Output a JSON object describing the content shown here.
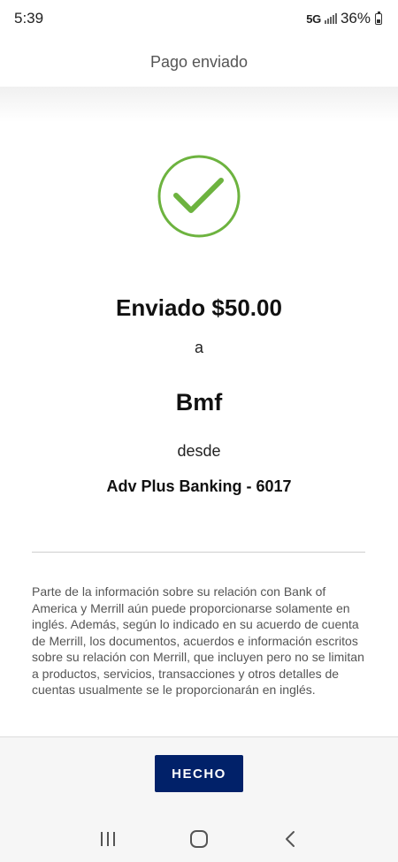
{
  "status_bar": {
    "time": "5:39",
    "network": "5G",
    "battery": "36%"
  },
  "header": {
    "title": "Pago enviado"
  },
  "confirmation": {
    "icon": "check-circle-icon",
    "check_color": "#6db33f",
    "sent_amount": "Enviado $50.00",
    "to_label": "a",
    "recipient": "Bmf",
    "from_label": "desde",
    "account": "Adv Plus Banking - 6017"
  },
  "disclaimer": "Parte de la información sobre su relación con Bank of America y Merrill aún puede proporcionarse solamente en inglés. Además, según lo indicado en su acuerdo de cuenta de Merrill, los documentos, acuerdos e información escritos sobre su relación con Merrill, que incluyen pero no se limitan a productos, servicios, transacciones y otros detalles de cuentas usualmente se le proporcionarán en inglés.",
  "footer": {
    "done_label": "HECHO",
    "button_color": "#012169"
  },
  "nav": {
    "recents": "recents-icon",
    "home": "home-icon",
    "back": "back-icon"
  }
}
